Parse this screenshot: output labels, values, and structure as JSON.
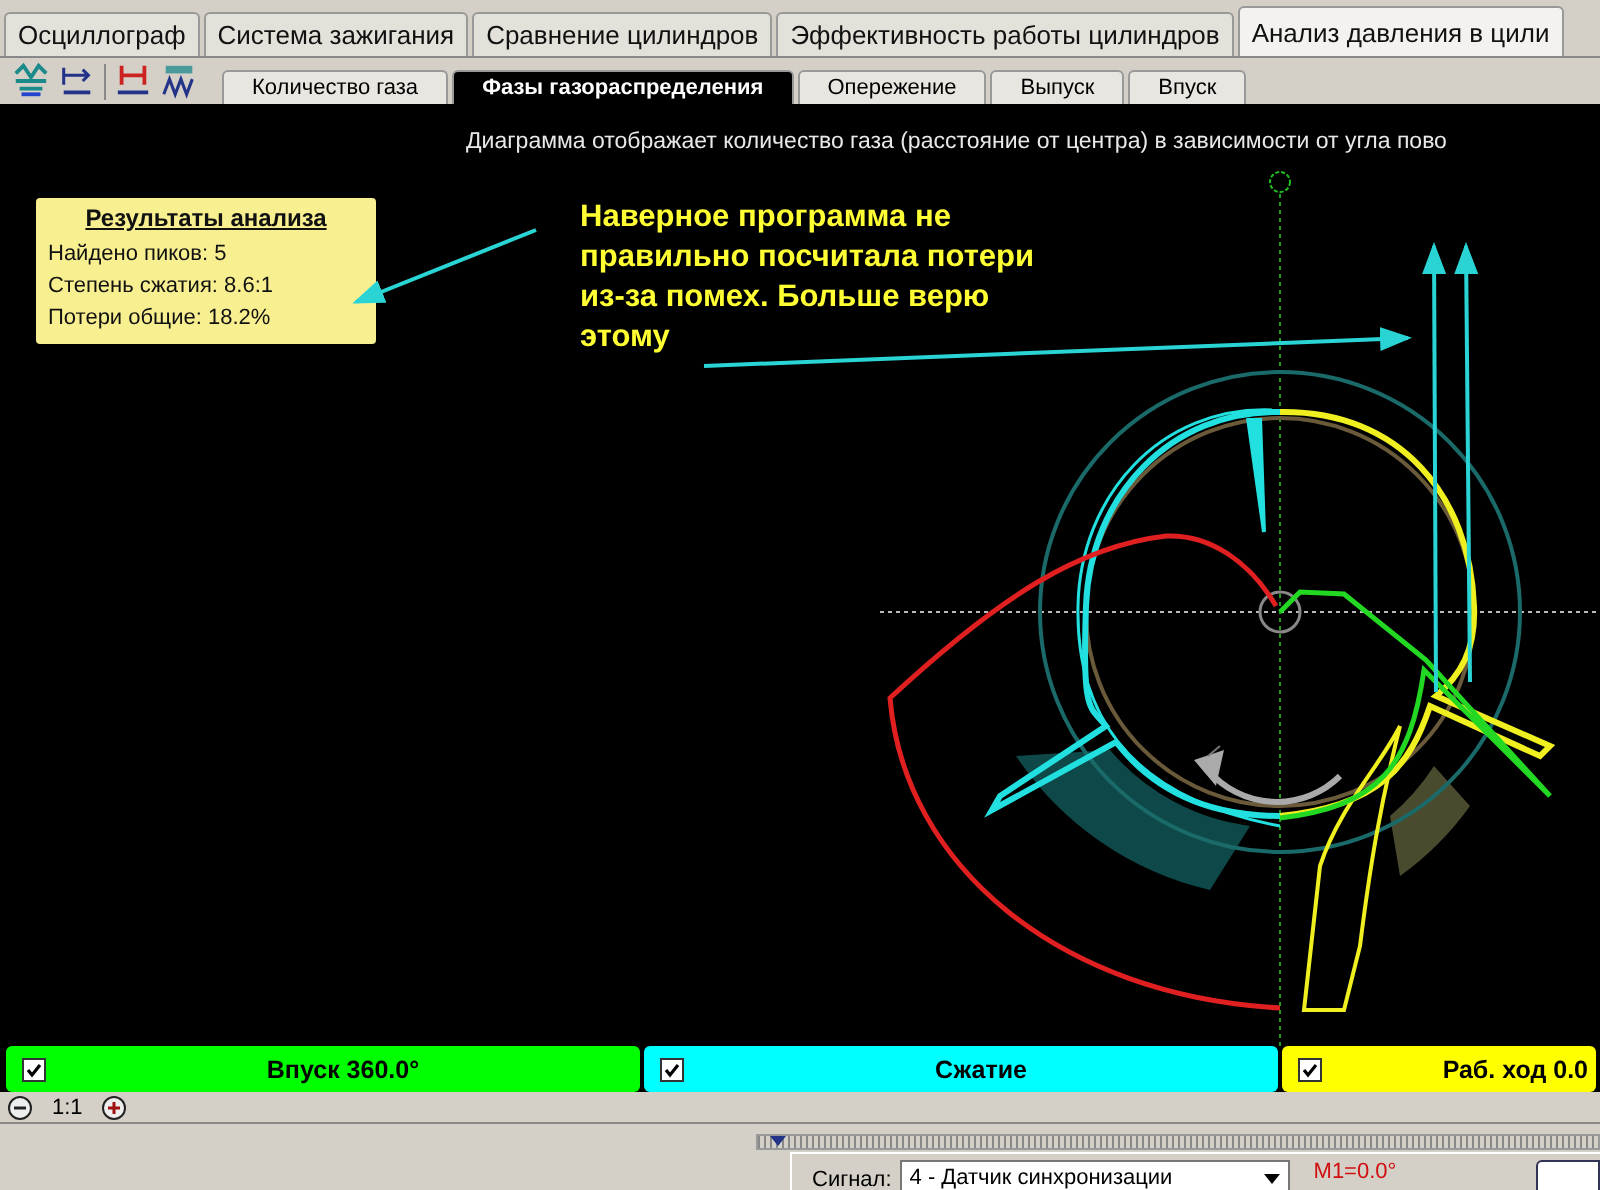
{
  "tabs": [
    {
      "label": "Осциллограф",
      "selected": false
    },
    {
      "label": "Система зажигания",
      "selected": false
    },
    {
      "label": "Сравнение цилиндров",
      "selected": false
    },
    {
      "label": "Эффективность работы цилиндров",
      "selected": false
    },
    {
      "label": "Анализ давления в цили",
      "selected": true
    }
  ],
  "subtabs": [
    {
      "label": "Количество газа",
      "selected": false
    },
    {
      "label": "Фазы газораспределения",
      "selected": true
    },
    {
      "label": "Опережение",
      "selected": false
    },
    {
      "label": "Выпуск",
      "selected": false
    },
    {
      "label": "Впуск",
      "selected": false
    }
  ],
  "diagram": {
    "caption": "Диаграмма отображает количество газа (расстояние от центра) в зависимости от угла пово",
    "results": {
      "title": "Результаты анализа",
      "lines": [
        "Найдено пиков: 5",
        "Степень сжатия: 8.6:1",
        "Потери общие: 18.2%"
      ]
    },
    "note": "Наверное программа не правильно посчитала потери из-за помех. Больше верю этому"
  },
  "phases": [
    {
      "label": "Впуск 360.0°",
      "checked": true,
      "color": "#00ff00"
    },
    {
      "label": "Сжатие",
      "checked": true,
      "color": "#00ffff"
    },
    {
      "label": "Раб. ход 0.0",
      "checked": true,
      "color": "#ffff00"
    }
  ],
  "zoom": {
    "label": "1:1"
  },
  "signal": {
    "label": "Сигнал:",
    "value": "4 - Датчик синхронизации",
    "marker": "M1=0.0°"
  }
}
